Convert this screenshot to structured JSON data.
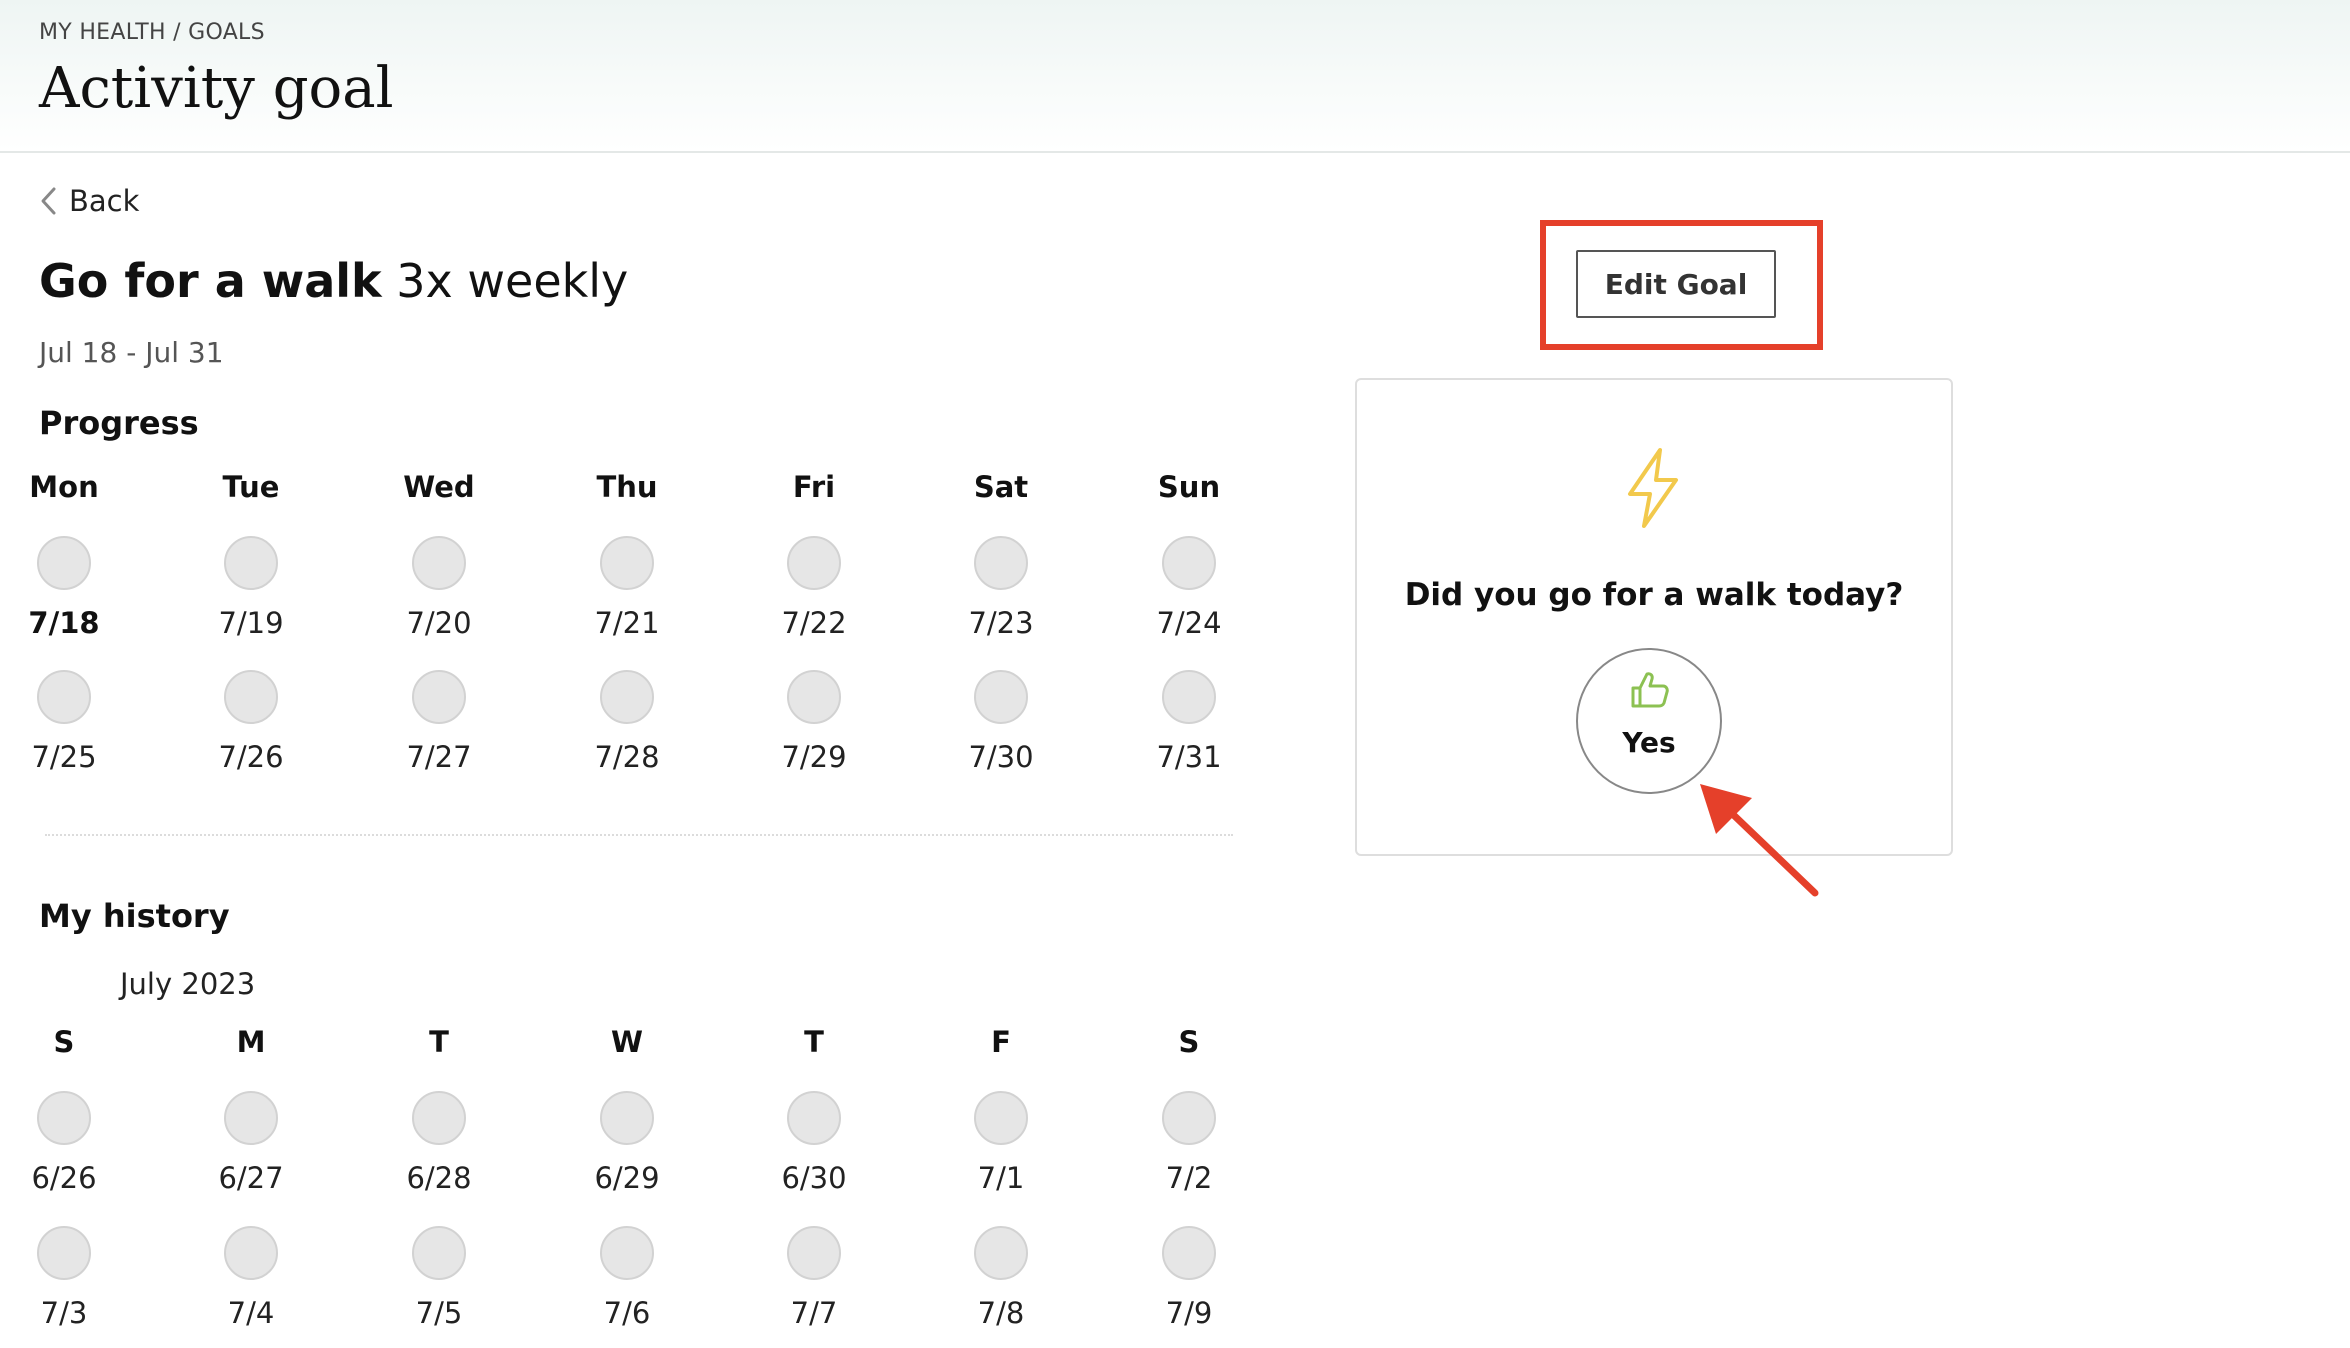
{
  "header": {
    "breadcrumb": "MY HEALTH / GOALS",
    "title": "Activity goal"
  },
  "back": {
    "label": "Back"
  },
  "goal": {
    "activity": "Go for a walk",
    "frequency": "3x weekly",
    "date_range": "Jul 18 - Jul 31"
  },
  "progress": {
    "title": "Progress",
    "days": [
      "Mon",
      "Tue",
      "Wed",
      "Thu",
      "Fri",
      "Sat",
      "Sun"
    ],
    "weeks": [
      [
        "7/18",
        "7/19",
        "7/20",
        "7/21",
        "7/22",
        "7/23",
        "7/24"
      ],
      [
        "7/25",
        "7/26",
        "7/27",
        "7/28",
        "7/29",
        "7/30",
        "7/31"
      ]
    ],
    "today": "7/18"
  },
  "history": {
    "title": "My history",
    "month": "July 2023",
    "days": [
      "S",
      "M",
      "T",
      "W",
      "T",
      "F",
      "S"
    ],
    "weeks": [
      [
        "6/26",
        "6/27",
        "6/28",
        "6/29",
        "6/30",
        "7/1",
        "7/2"
      ],
      [
        "7/3",
        "7/4",
        "7/5",
        "7/6",
        "7/7",
        "7/8",
        "7/9"
      ]
    ]
  },
  "edit_goal": {
    "label": "Edit Goal"
  },
  "checkin": {
    "icon": "lightning-bolt-icon",
    "question": "Did you go for a walk today?",
    "yes_label": "Yes",
    "yes_icon": "thumbs-up-icon"
  },
  "colors": {
    "accent_red": "#e5402a",
    "bolt_yellow": "#f2c94c",
    "thumb_green": "#8cc152",
    "dot_gray": "#e6e6e6"
  }
}
